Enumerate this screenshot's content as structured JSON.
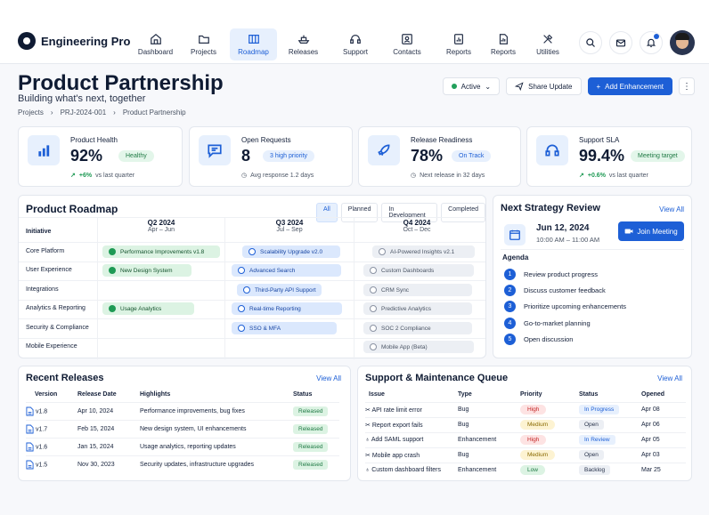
{
  "app": {
    "name": "Engineering Pro"
  },
  "nav": [
    {
      "label": "Dashboard",
      "icon": "home-icon"
    },
    {
      "label": "Projects",
      "icon": "folder-icon"
    },
    {
      "label": "Roadmap",
      "icon": "map-icon",
      "active": true
    },
    {
      "label": "Releases",
      "icon": "ship-icon"
    },
    {
      "label": "Support",
      "icon": "headset-icon"
    },
    {
      "label": "Contacts",
      "icon": "contact-icon"
    },
    {
      "label": "Reports",
      "icon": "chart-icon"
    },
    {
      "label": "Reports",
      "icon": "report-icon"
    },
    {
      "label": "Utilities",
      "icon": "tools-icon"
    }
  ],
  "header": {
    "title": "Product Partnership",
    "subtitle": "Building what's next, together",
    "breadcrumb": [
      "Projects",
      "PRJ-2024-001",
      "Product Partnership"
    ],
    "status": "Active",
    "share_label": "Share Update",
    "add_label": "Add Enhancement"
  },
  "kpis": [
    {
      "label": "Product Health",
      "value": "92%",
      "badge": "Healthy",
      "foot_delta": "+6%",
      "foot_text": "vs last quarter"
    },
    {
      "label": "Open Requests",
      "value": "8",
      "badge": "3 high priority",
      "foot_text": "Avg response 1.2 days"
    },
    {
      "label": "Release Readiness",
      "value": "78%",
      "badge": "On Track",
      "foot_text": "Next release in 32 days"
    },
    {
      "label": "Support SLA",
      "value": "99.4%",
      "badge": "Meeting target",
      "foot_delta": "+0.6%",
      "foot_text": "vs last quarter"
    }
  ],
  "roadmap": {
    "title": "Product Roadmap",
    "filters": [
      "All",
      "Planned",
      "In Development",
      "Completed"
    ],
    "initiative_header": "Initiative",
    "quarters": [
      {
        "name": "Q2 2024",
        "range": "Apr – Jun"
      },
      {
        "name": "Q3 2024",
        "range": "Jul – Sep"
      },
      {
        "name": "Q4 2024",
        "range": "Oct – Dec"
      }
    ],
    "rows": [
      "Core Platform",
      "User Experience",
      "Integrations",
      "Analytics & Reporting",
      "Security & Compliance",
      "Mobile Experience"
    ],
    "items": [
      "Performance Improvements v1.8",
      "Scalability Upgrade v2.0",
      "AI-Powered Insights v2.1",
      "New Design System",
      "Advanced Search",
      "Custom Dashboards",
      "Third-Party API Support",
      "CRM Sync",
      "Usage Analytics",
      "Real-time Reporting",
      "Predictive Analytics",
      "SSO & MFA",
      "SOC 2 Compliance",
      "Mobile App (Beta)"
    ]
  },
  "review": {
    "title": "Next Strategy Review",
    "view_all": "View All",
    "date": "Jun 12, 2024",
    "time": "10:00 AM – 11:00 AM",
    "join_label": "Join Meeting",
    "agenda_title": "Agenda",
    "agenda": [
      "Review product progress",
      "Discuss customer feedback",
      "Prioritize upcoming enhancements",
      "Go-to-market planning",
      "Open discussion"
    ]
  },
  "releases": {
    "title": "Recent Releases",
    "view_all": "View All",
    "columns": [
      "Version",
      "Release Date",
      "Highlights",
      "Status"
    ],
    "rows": [
      {
        "version": "v1.8",
        "date": "Apr 10, 2024",
        "highlights": "Performance improvements, bug fixes",
        "status": "Released"
      },
      {
        "version": "v1.7",
        "date": "Feb 15, 2024",
        "highlights": "New design system, UI enhancements",
        "status": "Released"
      },
      {
        "version": "v1.6",
        "date": "Jan 15, 2024",
        "highlights": "Usage analytics, reporting updates",
        "status": "Released"
      },
      {
        "version": "v1.5",
        "date": "Nov 30, 2023",
        "highlights": "Security updates, infrastructure upgrades",
        "status": "Released"
      }
    ]
  },
  "support": {
    "title": "Support & Maintenance Queue",
    "view_all": "View All",
    "columns": [
      "Issue",
      "Type",
      "Priority",
      "Status",
      "Opened"
    ],
    "rows": [
      {
        "issue": "API rate limit error",
        "type": "Bug",
        "priority": "High",
        "status": "In Progress",
        "opened": "Apr 08"
      },
      {
        "issue": "Report export fails",
        "type": "Bug",
        "priority": "Medium",
        "status": "Open",
        "opened": "Apr 06"
      },
      {
        "issue": "Add SAML support",
        "type": "Enhancement",
        "priority": "High",
        "status": "In Review",
        "opened": "Apr 05"
      },
      {
        "issue": "Mobile app crash",
        "type": "Bug",
        "priority": "Medium",
        "status": "Open",
        "opened": "Apr 03"
      },
      {
        "issue": "Custom dashboard filters",
        "type": "Enhancement",
        "priority": "Low",
        "status": "Backlog",
        "opened": "Mar 25"
      }
    ]
  }
}
